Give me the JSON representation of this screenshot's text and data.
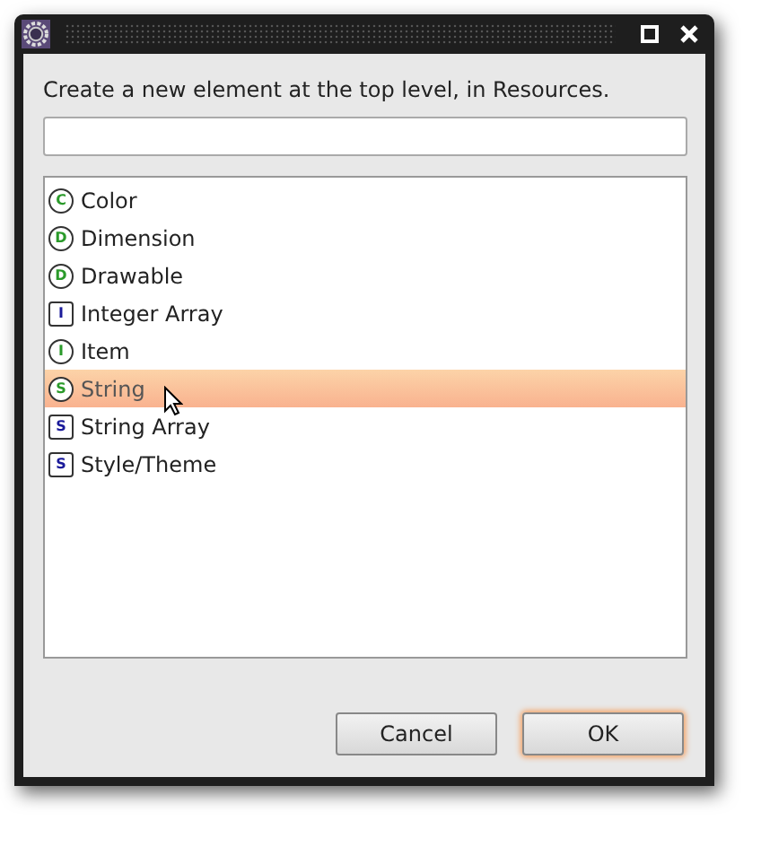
{
  "dialog": {
    "message": "Create a new element at the top level, in Resources.",
    "list": [
      {
        "badge": "C",
        "kind": "circle",
        "label": "Color",
        "selected": false
      },
      {
        "badge": "D",
        "kind": "circle",
        "label": "Dimension",
        "selected": false
      },
      {
        "badge": "D",
        "kind": "circle",
        "label": "Drawable",
        "selected": false
      },
      {
        "badge": "I",
        "kind": "square",
        "label": "Integer Array",
        "selected": false
      },
      {
        "badge": "I",
        "kind": "circle",
        "label": "Item",
        "selected": false
      },
      {
        "badge": "S",
        "kind": "circle",
        "label": "String",
        "selected": true
      },
      {
        "badge": "S",
        "kind": "square",
        "label": "String Array",
        "selected": false
      },
      {
        "badge": "S",
        "kind": "square",
        "label": "Style/Theme",
        "selected": false
      }
    ],
    "buttons": [
      {
        "label": "Cancel",
        "default": false
      },
      {
        "label": "OK",
        "default": true
      }
    ]
  }
}
